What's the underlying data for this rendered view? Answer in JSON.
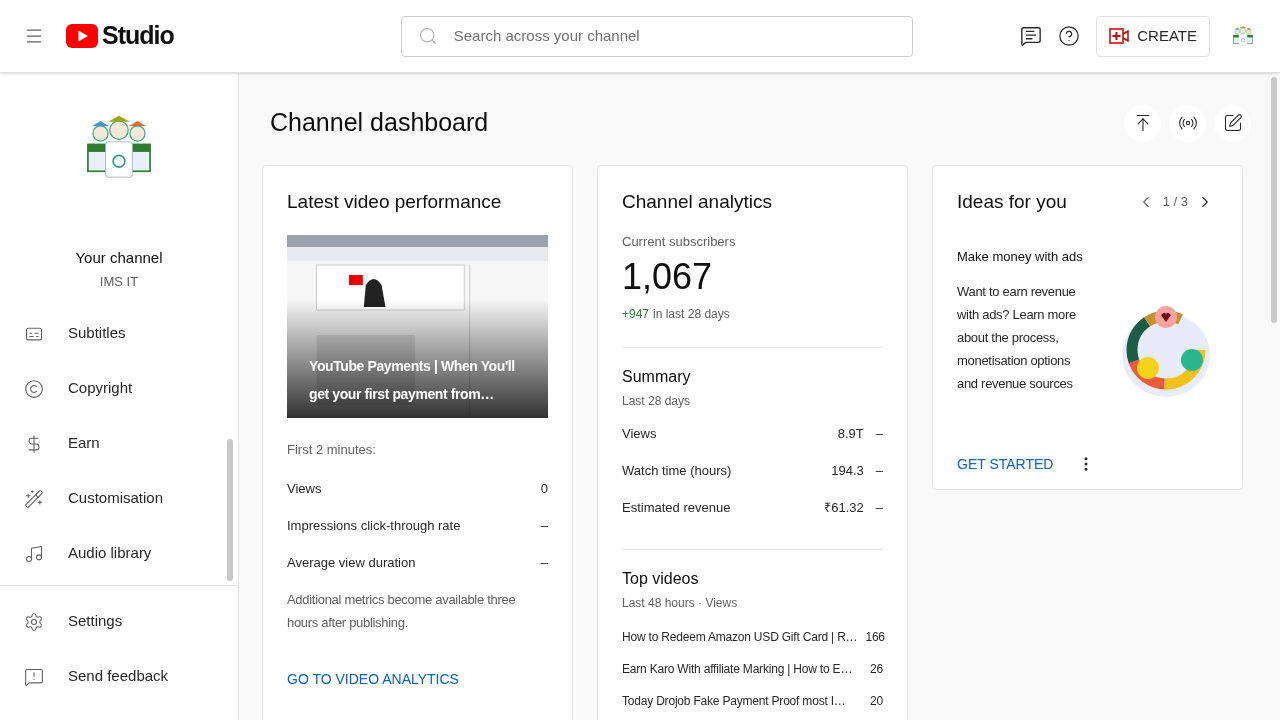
{
  "header": {
    "logo_text": "Studio",
    "search_placeholder": "Search across your channel",
    "create_label": "CREATE"
  },
  "sidebar": {
    "channel_label": "Your channel",
    "channel_name": "IMS IT",
    "items": [
      {
        "label": "Subtitles",
        "selected": false
      },
      {
        "label": "Copyright",
        "selected": false
      },
      {
        "label": "Earn",
        "selected": false
      },
      {
        "label": "Customisation",
        "selected": false
      },
      {
        "label": "Audio library",
        "selected": false
      }
    ],
    "footer_items": [
      {
        "label": "Settings",
        "selected": false
      },
      {
        "label": "Send feedback",
        "selected": false
      }
    ]
  },
  "page_title": "Channel dashboard",
  "latest_video": {
    "title": "Latest video performance",
    "video_title": "YouTube Payments | When You'll get your first payment from…",
    "period": "First 2 minutes:",
    "metrics": [
      {
        "label": "Views",
        "value": "0"
      },
      {
        "label": "Impressions click-through rate",
        "value": "–"
      },
      {
        "label": "Average view duration",
        "value": "–"
      }
    ],
    "note": "Additional metrics become available three hours after publishing.",
    "link": "GO TO VIDEO ANALYTICS"
  },
  "channel_analytics": {
    "title": "Channel analytics",
    "subscribers_label": "Current subscribers",
    "subscribers": "1,067",
    "change": "+947",
    "change_suffix": "in last 28 days",
    "summary_title": "Summary",
    "summary_period": "Last 28 days",
    "summary": [
      {
        "label": "Views",
        "value": "8.9T",
        "trend": "–"
      },
      {
        "label": "Watch time (hours)",
        "value": "194.3",
        "trend": "–"
      },
      {
        "label": "Estimated revenue",
        "value": "₹61.32",
        "trend": "–"
      }
    ],
    "top_title": "Top videos",
    "top_period": "Last 48 hours · Views",
    "top_videos": [
      {
        "title": "How to Redeem Amazon USD Gift Card | R…",
        "views": "166"
      },
      {
        "title": "Earn Karo With affiliate Marking | How to E…",
        "views": "26"
      },
      {
        "title": "Today Drojob Fake Payment Proof most I…",
        "views": "20"
      }
    ]
  },
  "ideas": {
    "title": "Ideas for you",
    "pager": "1 / 3",
    "heading": "Make money with ads",
    "body": "Want to earn revenue with ads? Learn more about the process, monetisation options and revenue sources",
    "action": "GET STARTED"
  }
}
